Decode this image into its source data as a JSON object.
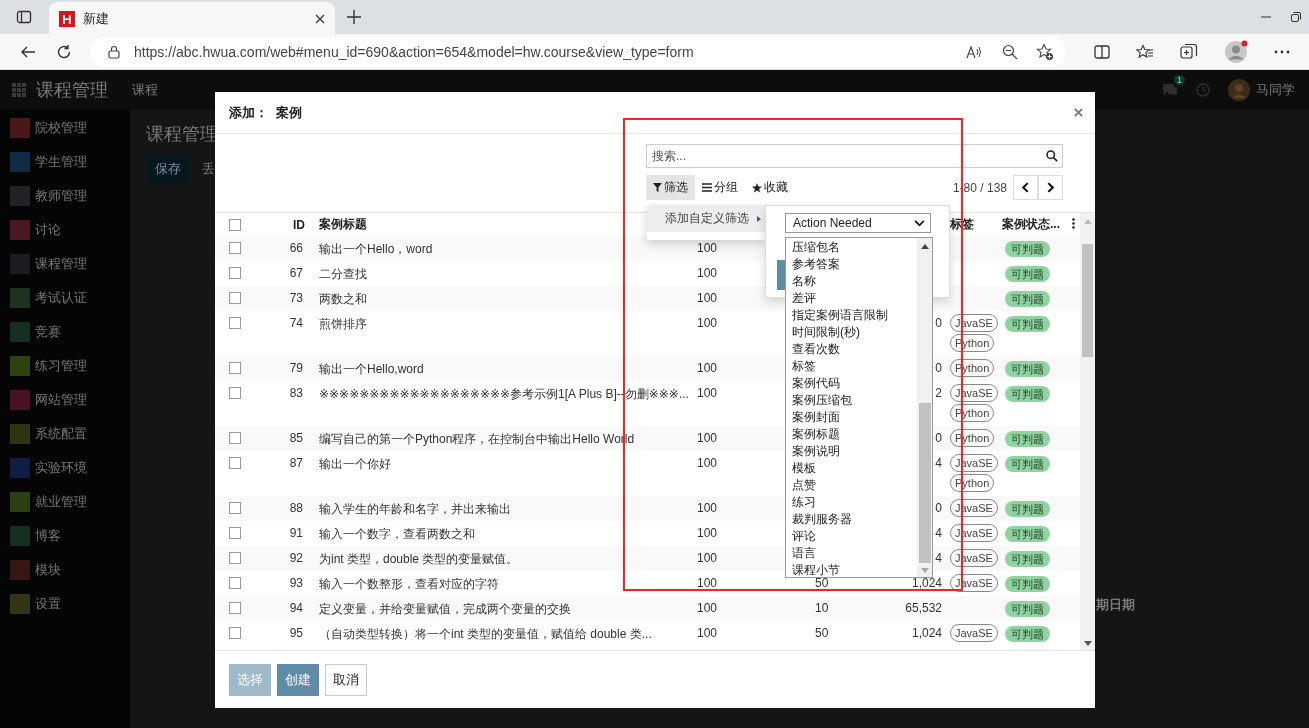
{
  "browser": {
    "favicon_letter": "H",
    "tab_title": "新建",
    "url": "https://abc.hwua.com/web#menu_id=690&action=654&model=hw.course&view_type=form"
  },
  "app": {
    "brand": "课程管理",
    "nav": [
      "课程"
    ],
    "badge": "1",
    "user": "马同学",
    "sidebar": [
      {
        "label": "院校管理",
        "color": "#4a1818"
      },
      {
        "label": "学生管理",
        "color": "#102a48"
      },
      {
        "label": "教师管理",
        "color": "#222226"
      },
      {
        "label": "讨论",
        "color": "#4a1820"
      },
      {
        "label": "课程管理",
        "color": "#1c1c22"
      },
      {
        "label": "考试认证",
        "color": "#1c3322"
      },
      {
        "label": "竞赛",
        "color": "#14301e"
      },
      {
        "label": "练习管理",
        "color": "#2e4210"
      },
      {
        "label": "网站管理",
        "color": "#4a1024"
      },
      {
        "label": "系统配置",
        "color": "#2c3412"
      },
      {
        "label": "实验环境",
        "color": "#0e1e44"
      },
      {
        "label": "就业管理",
        "color": "#2a4012"
      },
      {
        "label": "博客",
        "color": "#14301e"
      },
      {
        "label": "模块",
        "color": "#361616"
      },
      {
        "label": "设置",
        "color": "#343418"
      }
    ],
    "breadcrumb": "课程管理",
    "save_label": "保存",
    "discard_label": "丢",
    "side_label": "期日期"
  },
  "dialog": {
    "title": "添加： 案例",
    "search": {
      "placeholder": "搜索..."
    },
    "filters": [
      {
        "label": "筛选",
        "selected": true
      },
      {
        "label": "分组",
        "selected": false
      },
      {
        "label": "收藏",
        "selected": false
      }
    ],
    "all_checked": false,
    "pager": "1-80 / 138",
    "columns": [
      "ID",
      "案例标题",
      "标签",
      "案例状态..."
    ],
    "rows": [
      {
        "checked": false,
        "id": "66",
        "title": "输出一个Hello，word",
        "col_4": "100",
        "tags": [],
        "status": "可判题"
      },
      {
        "checked": false,
        "id": "67",
        "title": "二分查找",
        "col_4": "100",
        "tags": [],
        "status": "可判题"
      },
      {
        "checked": false,
        "id": "73",
        "title": "两数之和",
        "col_4": "100",
        "tags": [],
        "status": "可判题"
      },
      {
        "checked": false,
        "id": "74",
        "title": "煎饼排序",
        "col_4": "100",
        "col_6": "0",
        "tags": [
          "JavaSE",
          "Python"
        ],
        "status": "可判题"
      },
      {
        "checked": false,
        "id": "79",
        "title": "输出一个Hello,word",
        "col_4": "100",
        "col_6": "0",
        "tags": [
          "Python"
        ],
        "status": "可判题"
      },
      {
        "checked": false,
        "id": "83",
        "title": "※※※※※※※※※※※※※※※※※※※参考示例1[A Plus B]--勿删※※※...",
        "col_4": "100",
        "col_6": "2",
        "tags": [
          "JavaSE",
          "Python"
        ],
        "status": "可判题"
      },
      {
        "checked": false,
        "id": "85",
        "title": "编写自己的第一个Python程序，在控制台中输出Hello World",
        "col_4": "100",
        "col_6": "0",
        "tags": [
          "Python"
        ],
        "status": "可判题"
      },
      {
        "checked": false,
        "id": "87",
        "title": "输出一个你好",
        "col_4": "100",
        "col_6": "4",
        "tags": [
          "JavaSE",
          "Python"
        ],
        "status": "可判题"
      },
      {
        "checked": false,
        "id": "88",
        "title": "输入学生的年龄和名字，并出来输出",
        "col_4": "100",
        "col_6": "0",
        "tags": [
          "JavaSE"
        ],
        "status": "可判题"
      },
      {
        "checked": false,
        "id": "91",
        "title": "输入一个数字，查看两数之和",
        "col_4": "100",
        "col_6": "4",
        "tags": [
          "JavaSE"
        ],
        "status": "可判题"
      },
      {
        "checked": false,
        "id": "92",
        "title": "为int 类型，double 类型的变量赋值。",
        "col_4": "100",
        "col_6": "4",
        "tags": [
          "JavaSE"
        ],
        "status": "可判题"
      },
      {
        "checked": false,
        "id": "93",
        "title": "输入一个数整形，查看对应的字符",
        "col_4": "100",
        "col_5": "50",
        "col_6": "1,024",
        "tags": [
          "JavaSE"
        ],
        "status": "可判题"
      },
      {
        "checked": false,
        "id": "94",
        "title": "定义变量，并给变量赋值，完成两个变量的交换",
        "col_4": "100",
        "col_5": "10",
        "col_6": "65,532",
        "tags": [],
        "status": "可判题"
      },
      {
        "checked": false,
        "id": "95",
        "title": "（自动类型转换）将一个int 类型的变量值，赋值给 double 类...",
        "col_4": "100",
        "col_5": "50",
        "col_6": "1,024",
        "tags": [
          "JavaSE"
        ],
        "status": "可判题"
      }
    ],
    "filter_menu": {
      "item": "添加自定义筛选",
      "field_select": "Action Needed",
      "options": [
        "压缩包名",
        "参考答案",
        "名称",
        "差评",
        "指定案例语言限制",
        "时间限制(秒)",
        "查看次数",
        "标签",
        "案例代码",
        "案例压缩包",
        "案例封面",
        "案例标题",
        "案例说明",
        "模板",
        "点赞",
        "练习",
        "裁判服务器",
        "评论",
        "语言",
        "课程小节"
      ]
    },
    "buttons": [
      {
        "label": "选择",
        "kind": "primary",
        "disabled": true
      },
      {
        "label": "创建",
        "kind": "primary",
        "disabled": false
      },
      {
        "label": "取消",
        "kind": "default",
        "disabled": false
      }
    ]
  }
}
